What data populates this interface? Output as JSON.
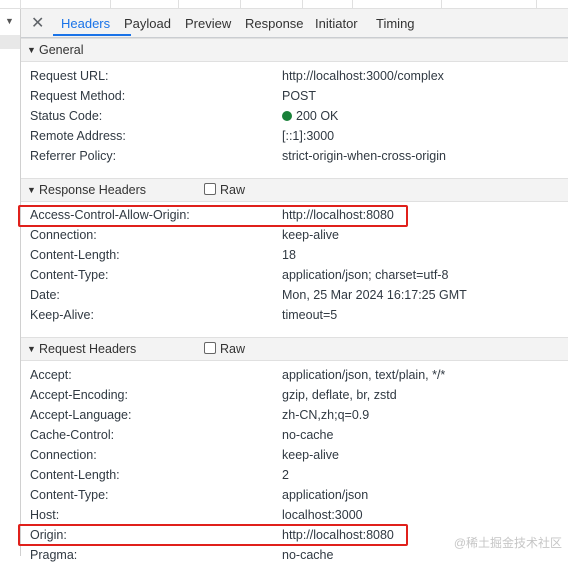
{
  "tabs": {
    "close_glyph": "✕",
    "items": [
      "Headers",
      "Payload",
      "Preview",
      "Response",
      "Initiator",
      "Timing"
    ],
    "active": "Headers"
  },
  "general": {
    "title": "General",
    "rows": [
      {
        "k": "Request URL:",
        "v": "http://localhost:3000/complex"
      },
      {
        "k": "Request Method:",
        "v": "POST"
      },
      {
        "k": "Status Code:",
        "v": "200 OK"
      },
      {
        "k": "Remote Address:",
        "v": "[::1]:3000"
      },
      {
        "k": "Referrer Policy:",
        "v": "strict-origin-when-cross-origin"
      }
    ]
  },
  "response_headers": {
    "title": "Response Headers",
    "raw_label": "Raw",
    "rows": [
      {
        "k": "Access-Control-Allow-Origin:",
        "v": "http://localhost:8080"
      },
      {
        "k": "Connection:",
        "v": "keep-alive"
      },
      {
        "k": "Content-Length:",
        "v": "18"
      },
      {
        "k": "Content-Type:",
        "v": "application/json; charset=utf-8"
      },
      {
        "k": "Date:",
        "v": "Mon, 25 Mar 2024 16:17:25 GMT"
      },
      {
        "k": "Keep-Alive:",
        "v": "timeout=5"
      }
    ]
  },
  "request_headers": {
    "title": "Request Headers",
    "raw_label": "Raw",
    "rows": [
      {
        "k": "Accept:",
        "v": "application/json, text/plain, */*"
      },
      {
        "k": "Accept-Encoding:",
        "v": "gzip, deflate, br, zstd"
      },
      {
        "k": "Accept-Language:",
        "v": "zh-CN,zh;q=0.9"
      },
      {
        "k": "Cache-Control:",
        "v": "no-cache"
      },
      {
        "k": "Connection:",
        "v": "keep-alive"
      },
      {
        "k": "Content-Length:",
        "v": "2"
      },
      {
        "k": "Content-Type:",
        "v": "application/json"
      },
      {
        "k": "Host:",
        "v": "localhost:3000"
      },
      {
        "k": "Origin:",
        "v": "http://localhost:8080"
      },
      {
        "k": "Pragma:",
        "v": "no-cache"
      }
    ]
  },
  "colors": {
    "accent": "#1a73e8",
    "status_ok": "#188038",
    "highlight": "#e0201b"
  },
  "watermark": "@稀土掘金技术社区"
}
